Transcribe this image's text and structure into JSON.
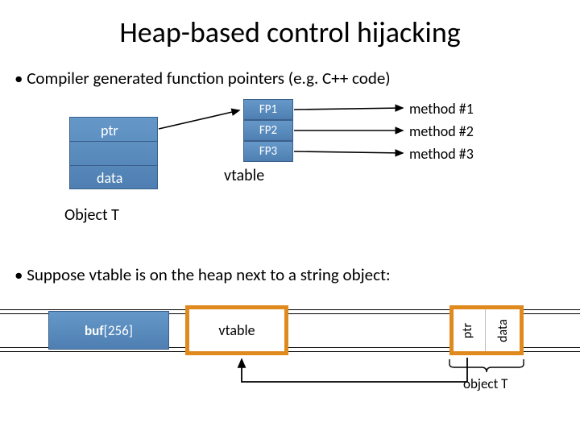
{
  "title": "Heap-based control hijacking",
  "bullet1": "Compiler generated function pointers   (e.g.  C++ code)",
  "bullet2": "Suppose   vtable   is on the heap next to a string object:",
  "object": {
    "ptr": "ptr",
    "data": "data",
    "label": "Object  T"
  },
  "vtable": {
    "fp1": "FP1",
    "fp2": "FP2",
    "fp3": "FP3",
    "label": "vtable"
  },
  "methods": {
    "m1": "method #1",
    "m2": "method #2",
    "m3": "method #3"
  },
  "heap": {
    "buf_bold": "buf",
    "buf_thin": "[256]",
    "vtable": "vtable",
    "ptr": "ptr",
    "data": "data",
    "objT": "object T"
  }
}
